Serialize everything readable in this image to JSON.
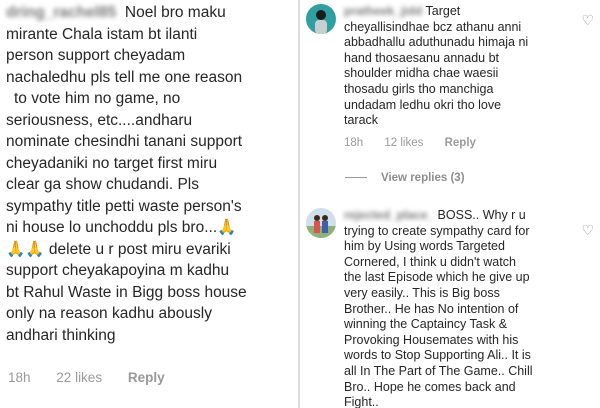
{
  "left_comment": {
    "username": "dring_rachel85",
    "lines": [
      "Noel bro maku",
      "mirante Chala istam bt ilanti",
      "person support cheyadam",
      "nachaledhu pls tell me one reason",
      "to  vote him no game, no",
      "seriousness, etc....andharu",
      "nominate chesindhi tanani support",
      "cheyadaniki no target first miru",
      "clear ga show chudandi. Pls",
      "sympathy title petti waste person's",
      "ni house lo unchoddu pls bro...🙏",
      "🙏🙏  delete u r post miru evariki",
      "support cheyakapoyina m kadhu",
      "bt Rahul Waste in Bigg boss house",
      "only na reason kadhu abously",
      "andhari thinking"
    ],
    "time": "18h",
    "likes": "22 likes",
    "reply": "Reply"
  },
  "right_comment_1": {
    "username": "pratheek_jidd",
    "lines": [
      "Target",
      "cheyallisindhae bcz athanu anni",
      "abbadhallu aduthunadu himaja ni",
      "hand thosaesanu annadu bt",
      "shoulder midha chae waesii",
      "thosadu girls tho manchiga",
      "undadam ledhu okri tho love",
      "tarack"
    ],
    "time": "18h",
    "likes": "12 likes",
    "reply": "Reply",
    "like_icon": "heart-outline-icon"
  },
  "view_replies": "View replies (3)",
  "right_comment_2": {
    "username": "rejected_place_",
    "lines": [
      "BOSS.. Why r u",
      "trying to create sympathy card for",
      "him by Using words Targeted",
      "Cornered, I think u didn't watch",
      "the last Episode which he give up",
      "very easily.. This is Big boss",
      "Brother.. He has No intention of",
      "winning the Captaincy Task &",
      "Provoking Housemates with his",
      "words to Stop Supporting Ali.. It is",
      "all In The Part of The Game.. Chill",
      "Bro.. Hope he comes back and",
      "Fight.."
    ],
    "like_icon": "heart-outline-icon"
  }
}
